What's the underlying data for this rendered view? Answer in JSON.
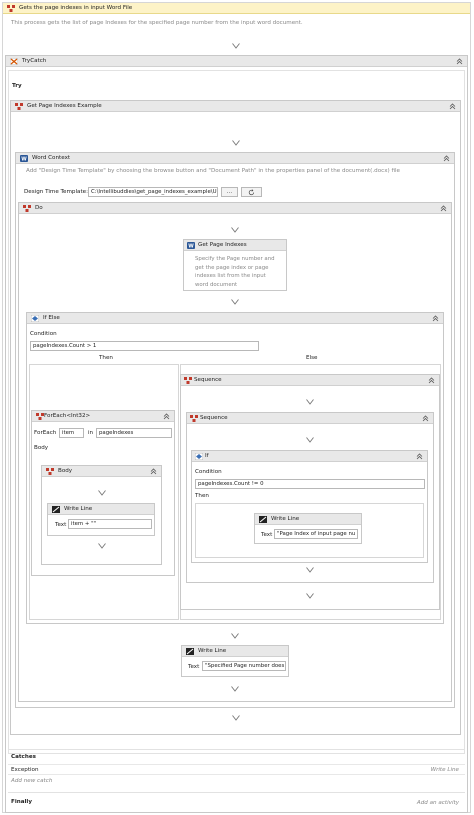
{
  "root": {
    "title": "Gets the page indexes in input Word File",
    "description": "This process gets the list of page Indexes for the specified page number from the input word document."
  },
  "trycatch": {
    "title": "TryCatch",
    "try_label": "Try",
    "catches_label": "Catches",
    "exception_label": "Exception",
    "exception_action": "Write Line",
    "add_new_catch": "Add new catch",
    "finally_label": "Finally",
    "add_activity": "Add an activity"
  },
  "example": {
    "title": "Get Page Indexes Example"
  },
  "word_context": {
    "title": "Word Context",
    "hint": "Add \"Design Time Template\" by choosing the browse button and \"Document Path\" in the properties panel of the document(.docx) file",
    "template_label": "Design Time Template:",
    "template_value": "C:\\Intellibuddies\\get_page_indexes_example\\Ub",
    "browse_label": "..."
  },
  "do_block": {
    "title": "Do"
  },
  "get_page_indexes": {
    "title": "Get Page Indexes",
    "description": "Specify the Page number and get the page index or page indexes list from the input word document"
  },
  "if_else": {
    "title": "If Else",
    "condition_label": "Condition",
    "condition_value": "pageIndexes.Count > 1",
    "then_label": "Then",
    "else_label": "Else"
  },
  "foreach": {
    "title": "ForEach<Int32>",
    "foreach_label": "ForEach",
    "item_value": "item",
    "in_label": "in",
    "collection_value": "pageIndexes",
    "body_label": "Body"
  },
  "body": {
    "title": "Body"
  },
  "write_line_1": {
    "title": "Write Line",
    "text_label": "Text",
    "text_value": "item + \"\""
  },
  "sequence_outer": {
    "title": "Sequence"
  },
  "sequence_inner": {
    "title": "Sequence"
  },
  "if_block": {
    "title": "If",
    "condition_label": "Condition",
    "condition_value": "pageIndexes.Count != 0",
    "then_label": "Then"
  },
  "write_line_2": {
    "title": "Write Line",
    "text_label": "Text",
    "text_value": "\"Page Index of input page nu"
  },
  "write_line_3": {
    "title": "Write Line",
    "text_label": "Text",
    "text_value": "\"Specified Page number does"
  },
  "icons": {
    "sequence": "sequence-icon",
    "trycatch": "trycatch-icon",
    "word": "word-icon",
    "writeline": "write-line-icon",
    "collapse": "collapse-chevron-icon",
    "arrow": "drop-arrow-icon",
    "refresh": "refresh-icon"
  },
  "colors": {
    "root_header": "#fdf3c7",
    "header": "#e8e8e8",
    "border": "#c8c8c8",
    "word_blue": "#2b5797",
    "sequence_red": "#c0392b"
  }
}
